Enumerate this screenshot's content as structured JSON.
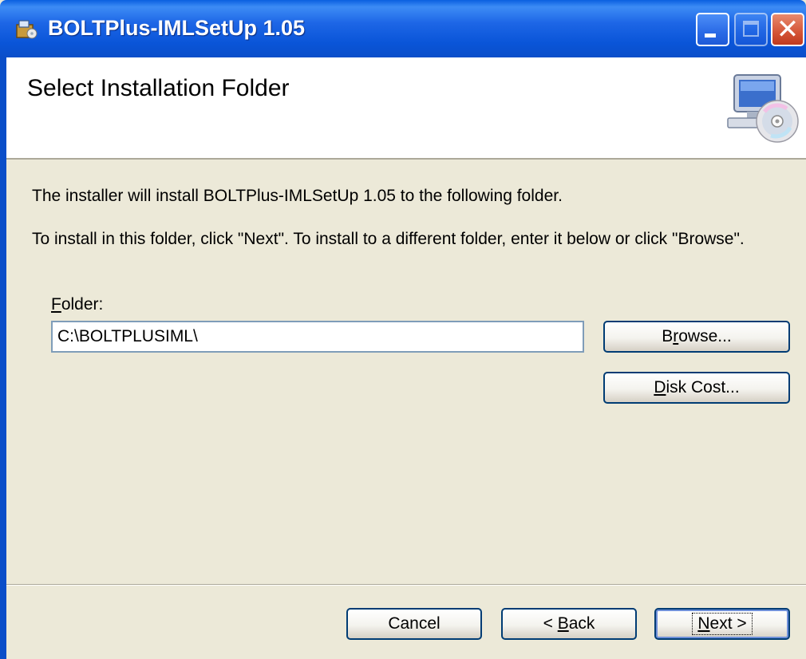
{
  "window": {
    "title": "BOLTPlus-IMLSetUp 1.05",
    "close_glyph": "✕",
    "colors": {
      "titlebar": "#0a55d8",
      "face": "#ece9d8",
      "close": "#d45436"
    }
  },
  "banner": {
    "heading": "Select Installation Folder",
    "icon": "computer-cd-icon"
  },
  "body": {
    "line1": "The installer will install BOLTPlus-IMLSetUp 1.05 to the following folder.",
    "line2": "To install in this folder, click \"Next\". To install to a different folder, enter it below or click \"Browse\".",
    "folder_label_mnemonic": "F",
    "folder_label_rest": "older:",
    "folder_value": "C:\\BOLTPLUSIML\\"
  },
  "buttons": {
    "browse_a": "B",
    "browse_mnemonic": "r",
    "browse_b": "owse...",
    "disk_mnemonic": "D",
    "disk_rest": "isk Cost...",
    "cancel": "Cancel",
    "back_prefix": "< ",
    "back_mnemonic": "B",
    "back_rest": "ack",
    "next_mnemonic": "N",
    "next_rest": "ext >"
  }
}
